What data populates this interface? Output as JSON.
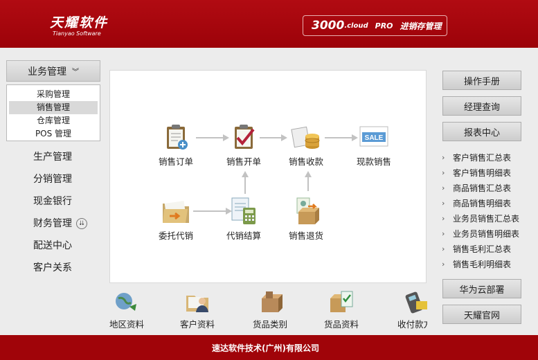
{
  "header": {
    "logo_cn": "天耀软件",
    "logo_en": "Tianyao Software",
    "product_num": "3000",
    "product_cloud": ".cloud",
    "product_pro": "PRO",
    "product_name": "进销存管理"
  },
  "sidebar": {
    "top_section": "业务管理",
    "sub_items": [
      "采购管理",
      "销售管理",
      "仓库管理",
      "POS 管理"
    ],
    "active_sub": "销售管理",
    "items": [
      "生产管理",
      "分销管理",
      "现金银行",
      "财务管理",
      "配送中心",
      "客户关系"
    ]
  },
  "flow": {
    "sales_order": "销售订单",
    "sales_invoice": "销售开单",
    "sales_receipt": "销售收款",
    "cash_sale": "现款销售",
    "consignment": "委托代销",
    "consign_settle": "代销结算",
    "sales_return": "销售退货",
    "sale_tag": "SALE"
  },
  "bottom": [
    "地区资料",
    "客户资料",
    "货品类别",
    "货品资料",
    "收付款方"
  ],
  "right": {
    "manual": "操作手册",
    "manager_query": "经理查询",
    "report_center": "报表中心",
    "reports": [
      "客户销售汇总表",
      "客户销售明细表",
      "商品销售汇总表",
      "商品销售明细表",
      "业务员销售汇总表",
      "业务员销售明细表",
      "销售毛利汇总表",
      "销售毛利明细表"
    ],
    "huawei": "华为云部署",
    "official": "天耀官网"
  },
  "footer": {
    "company": "速达软件技术(广州)有限公司"
  },
  "colors": {
    "header_red": "#a8070d",
    "footer_red": "#a00409",
    "background": "#ececec"
  }
}
